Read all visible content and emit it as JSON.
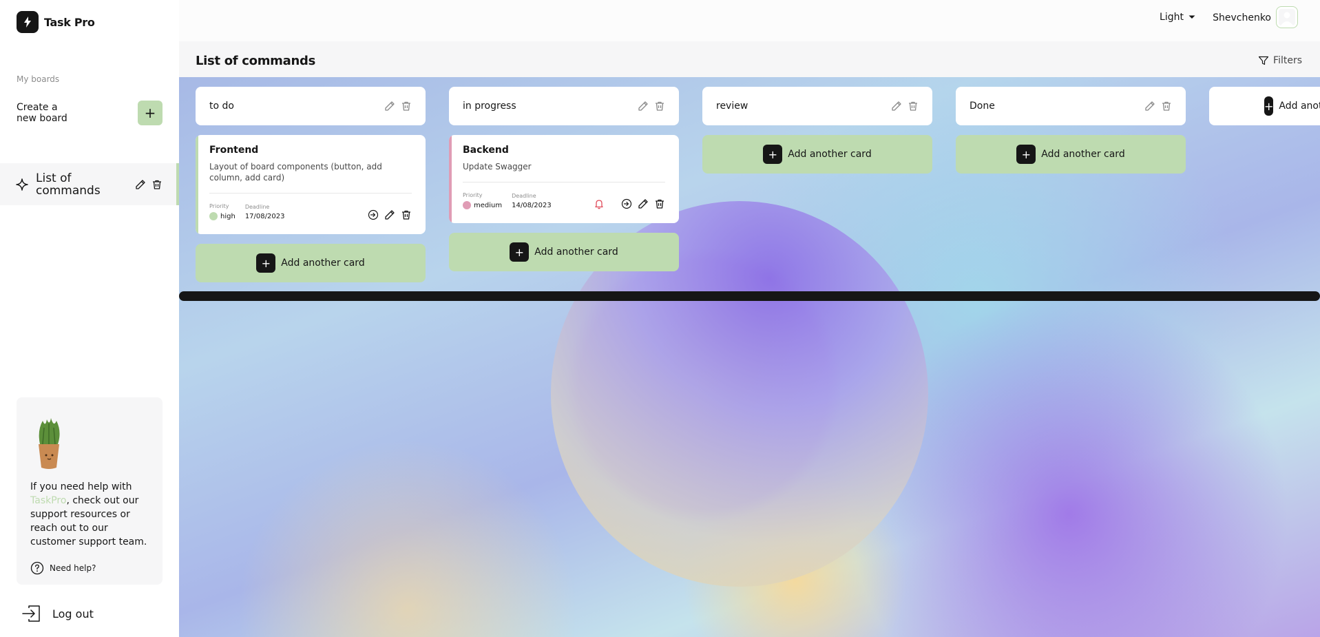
{
  "app": {
    "name": "Task Pro"
  },
  "sidebar": {
    "my_boards_label": "My boards",
    "create_board_label": "Create a new board",
    "create_icon": "plus-icon",
    "boards": [
      {
        "label": "List of commands",
        "icon": "sparkle-icon"
      }
    ],
    "help": {
      "text_before": "If you need help with ",
      "link": "TaskPro",
      "text_after": ", check out our support resources or reach out to our customer support team.",
      "need_help": "Need help?"
    },
    "logout": "Log out"
  },
  "header": {
    "theme": "Light",
    "user_name": "Shevchenko"
  },
  "board": {
    "title": "List of commands",
    "filters_label": "Filters",
    "add_column_label": "Add another column",
    "add_card_label": "Add another card",
    "columns": [
      {
        "title": "to do",
        "cards": [
          {
            "title": "Frontend",
            "description": "Layout of board components (button, add column, add card)",
            "priority_label": "Priority",
            "priority": "high",
            "deadline_label": "Deadline",
            "deadline": "17/08/2023"
          }
        ]
      },
      {
        "title": "in progress",
        "cards": [
          {
            "title": "Backend",
            "description": "Update Swagger",
            "priority_label": "Priority",
            "priority": "medium",
            "deadline_label": "Deadline",
            "deadline": "14/08/2023"
          }
        ]
      },
      {
        "title": "review",
        "cards": []
      },
      {
        "title": "Done",
        "cards": []
      }
    ]
  },
  "colors": {
    "accent": "#bedbb0",
    "high": "#bedbb0",
    "medium": "#e09cb5",
    "dark": "#161616",
    "bell": "#e04b5a"
  }
}
